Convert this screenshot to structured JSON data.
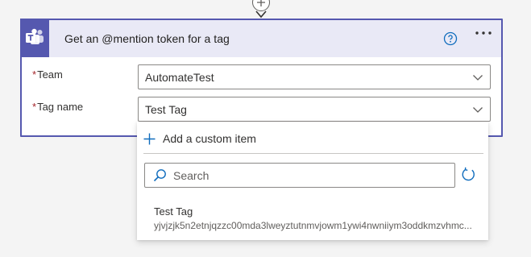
{
  "card": {
    "title": "Get an @mention token for a tag"
  },
  "fields": {
    "team": {
      "label": "Team",
      "required_mark": "*",
      "value": "AutomateTest"
    },
    "tag_name": {
      "label": "Tag name",
      "required_mark": "*",
      "value": "Test Tag"
    }
  },
  "dropdown": {
    "add_custom_label": "Add a custom item",
    "search_placeholder": "Search",
    "items": [
      {
        "name": "Test Tag",
        "id": "yjvjzjk5n2etnjqzzc00mda3lweyztutnmvjowm1ywi4nwniiym3oddkmzvhmc..."
      }
    ]
  },
  "icons": {
    "app": "teams-icon",
    "help": "help-icon",
    "more": "more-icon",
    "chevron": "chevron-down-icon",
    "plus": "plus-icon",
    "search": "search-icon",
    "refresh": "refresh-icon"
  },
  "colors": {
    "accent": "#5558af",
    "header_bg": "#e9e9f6",
    "required": "#a4262c",
    "link_blue": "#0f6cbd"
  }
}
